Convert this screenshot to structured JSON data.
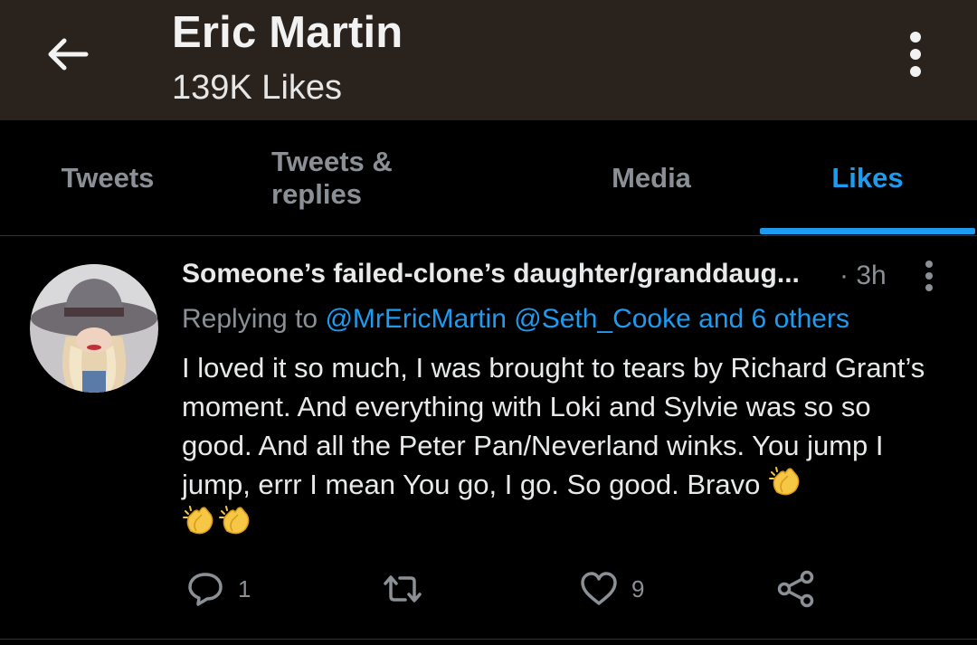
{
  "header": {
    "title": "Eric Martin",
    "subtitle": "139K Likes",
    "back_icon": "arrow-left-icon",
    "more_icon": "more-vertical-icon",
    "background": "#2a221d"
  },
  "tabs": [
    {
      "label": "Tweets",
      "active": false
    },
    {
      "label": "Tweets & replies",
      "active": false
    },
    {
      "label": "Media",
      "active": false
    },
    {
      "label": "Likes",
      "active": true
    }
  ],
  "accent_color": "#1d9bf0",
  "tweet": {
    "display_name": "Someone’s failed-clone’s daughter/granddaug...",
    "time": "· 3h",
    "replying_prefix": "Replying to",
    "mentions": [
      "@MrEricMartin",
      "@Seth_Cooke",
      "and 6 others"
    ],
    "text": "I loved it so much, I was brought to tears by Richard Grant’s moment. And everything with Loki and Sylvie was so so good. And all the  Peter Pan/Neverland winks. You jump I jump, errr I mean You go, I go. So good. Bravo",
    "emoji": "clapping-hands-emoji",
    "actions": {
      "reply_count": "1",
      "retweet_count": "",
      "like_count": "9"
    }
  }
}
